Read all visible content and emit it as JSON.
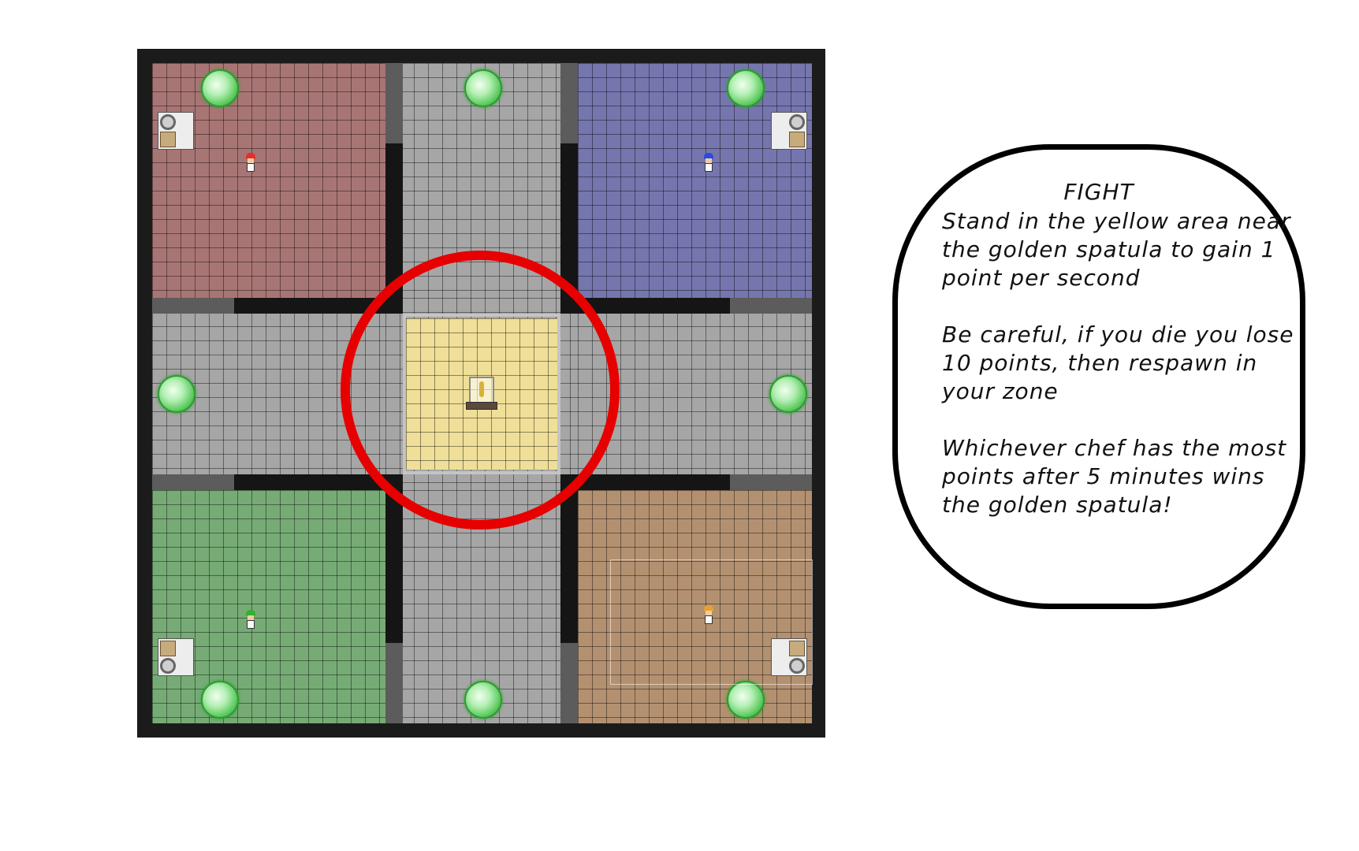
{
  "instructions": {
    "title": "FIGHT",
    "paragraphs": [
      "Stand in the yellow area near the golden spatula to gain 1 point per second",
      "Be careful, if you die you lose 10 points, then respawn in your zone",
      "Whichever chef has the most points after 5 minutes wins the golden spatula!"
    ]
  },
  "colors": {
    "red_zone": "#a87575",
    "blue_zone": "#7676ae",
    "green_zone": "#76ab76",
    "orange_zone": "#b39170",
    "neutral_floor": "#a6a6a6",
    "capture_area": "#efdf98",
    "highlight_ring": "#e60000",
    "portal": "#58c85a"
  },
  "map": {
    "zones": [
      {
        "name": "red",
        "chef_hat_color": "#e03030"
      },
      {
        "name": "blue",
        "chef_hat_color": "#2b4bd8"
      },
      {
        "name": "green",
        "chef_hat_color": "#32b030"
      },
      {
        "name": "orange",
        "chef_hat_color": "#e8a030"
      }
    ],
    "portal_count": 8,
    "objective": "golden-spatula"
  }
}
